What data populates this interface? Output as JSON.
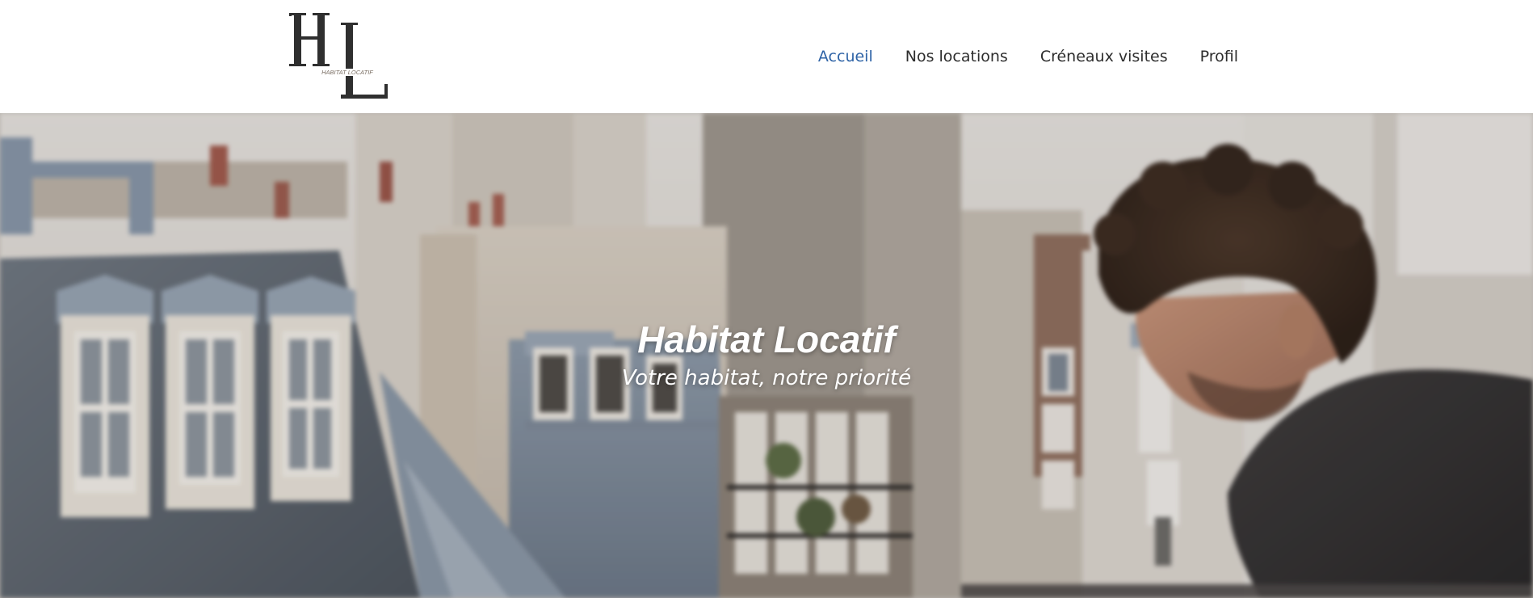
{
  "logo": {
    "letters": "HL",
    "tagline": "HABITAT LOCATIF"
  },
  "nav": {
    "items": [
      {
        "label": "Accueil",
        "active": true
      },
      {
        "label": "Nos locations",
        "active": false
      },
      {
        "label": "Créneaux visites",
        "active": false
      },
      {
        "label": "Profil",
        "active": false
      }
    ]
  },
  "hero": {
    "title": "Habitat Locatif",
    "subtitle": "Votre habitat, notre priorité"
  },
  "colors": {
    "nav_active": "#2e63a6",
    "nav_default": "#2d2d2d",
    "logo": "#2f2f2f"
  }
}
